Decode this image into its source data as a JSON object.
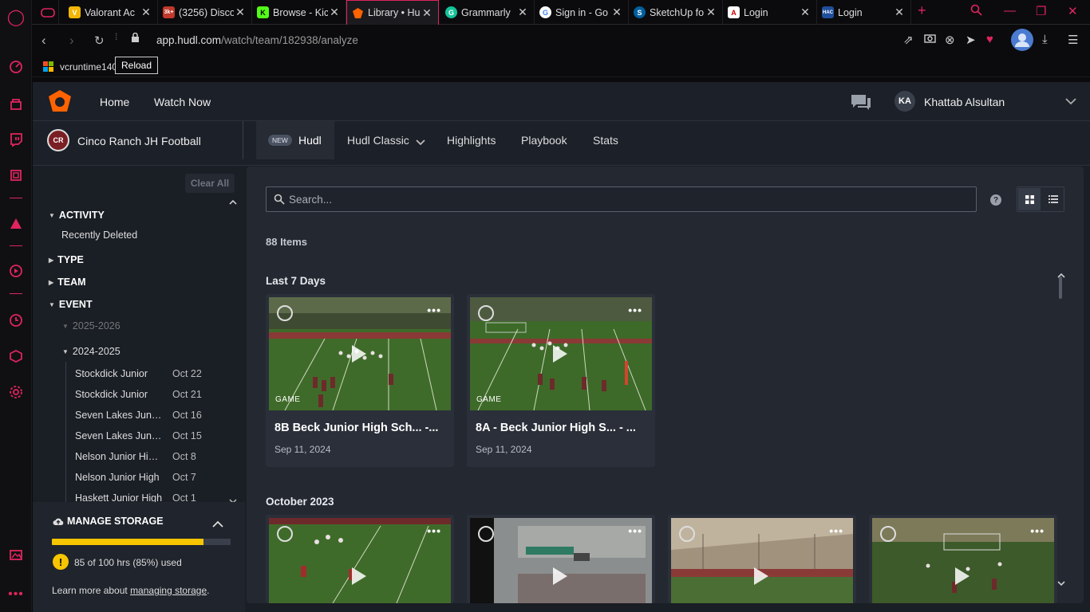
{
  "browser": {
    "tabs": [
      {
        "title": "Valorant Ac",
        "fav": "V",
        "fav_color": "#f2b705"
      },
      {
        "title": "(3256) Disco",
        "fav": "3k+",
        "fav_color": "#5865f2"
      },
      {
        "title": "Browse - Kic",
        "fav": "K",
        "fav_color": "#53fc18"
      },
      {
        "title": "Library • Hu",
        "fav": "",
        "fav_color": "#ff6300"
      },
      {
        "title": "Grammarly",
        "fav": "G",
        "fav_color": "#15c39a"
      },
      {
        "title": "Sign in - Go",
        "fav": "G",
        "fav_color": "#ffffff"
      },
      {
        "title": "SketchUp fo",
        "fav": "S",
        "fav_color": "#005f9e"
      },
      {
        "title": "Login",
        "fav": "A",
        "fav_color": "#ffffff"
      },
      {
        "title": "Login",
        "fav": "HAC",
        "fav_color": "#1f4e9c"
      }
    ],
    "url_host": "app.hudl.com",
    "url_path": "/watch/team/182938/analyze",
    "bookmark": "vcruntime140",
    "tooltip": "Reload"
  },
  "topnav": {
    "home": "Home",
    "watch_now": "Watch Now",
    "user_initials": "KA",
    "user_name": "Khattab Alsultan"
  },
  "subnav": {
    "team_name": "Cinco Ranch JH Football",
    "new_badge": "NEW",
    "hudl": "Hudl",
    "hudl_classic": "Hudl Classic",
    "highlights": "Highlights",
    "playbook": "Playbook",
    "stats": "Stats"
  },
  "filters": {
    "clear_all": "Clear All",
    "activity": "ACTIVITY",
    "recently_deleted": "Recently Deleted",
    "type": "TYPE",
    "team": "TEAM",
    "event": "EVENT",
    "season_1": "2025-2026",
    "season_2": "2024-2025",
    "events": [
      {
        "name": "Stockdick Junior",
        "date": "Oct 22"
      },
      {
        "name": "Stockdick Junior",
        "date": "Oct 21"
      },
      {
        "name": "Seven Lakes Juni…",
        "date": "Oct 16"
      },
      {
        "name": "Seven Lakes Juni…",
        "date": "Oct 15"
      },
      {
        "name": "Nelson Junior High …",
        "date": "Oct 8"
      },
      {
        "name": "Nelson Junior High",
        "date": "Oct 7"
      },
      {
        "name": "Haskett Junior High",
        "date": "Oct 1"
      }
    ]
  },
  "storage": {
    "title": "MANAGE STORAGE",
    "used_text": "85 of 100 hrs (85%) used",
    "used_fraction": 0.85,
    "learn_prefix": "Learn more about ",
    "learn_link": "managing storage",
    "learn_suffix": "."
  },
  "library": {
    "search_placeholder": "Search...",
    "item_count": "88 Items",
    "section_1": "Last 7 Days",
    "section_2": "October 2023",
    "cards": [
      {
        "tag": "GAME",
        "title": "8B Beck Junior High Sch... -...",
        "date": "Sep 11, 2024"
      },
      {
        "tag": "GAME",
        "title": "8A - Beck Junior High S... - ...",
        "date": "Sep 11, 2024"
      }
    ]
  }
}
